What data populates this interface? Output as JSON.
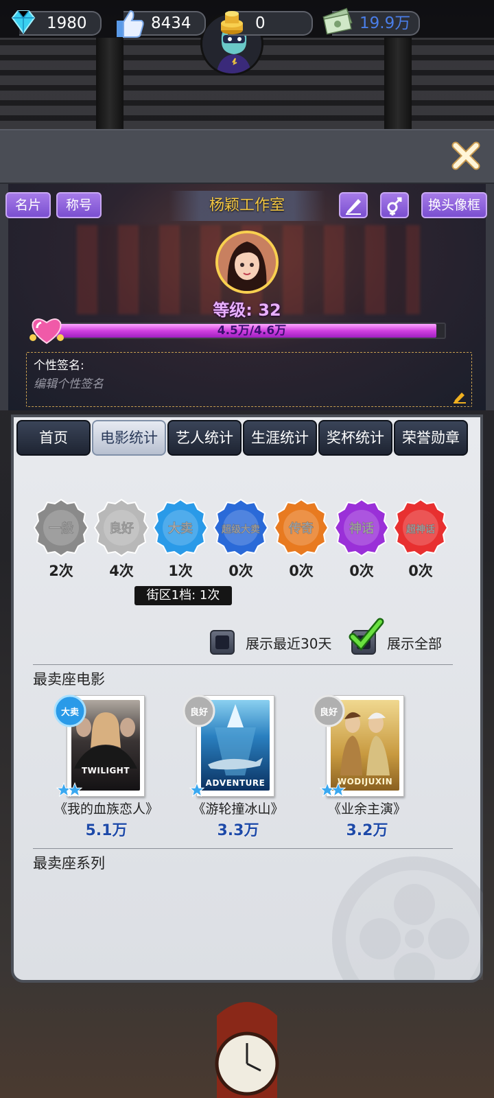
{
  "resources": [
    {
      "icon": "diamond-icon",
      "value": "1980"
    },
    {
      "icon": "thumbs-up-icon",
      "value": "8434"
    },
    {
      "icon": "gold-coins-icon",
      "value": "0"
    },
    {
      "icon": "cash-icon",
      "value": "19.9万",
      "color": "#4a7ee8"
    }
  ],
  "profile": {
    "card_label": "名片",
    "title_label": "称号",
    "studio_name": "杨颖工作室",
    "frame_label": "换头像框",
    "level": "等级: 32",
    "xp_text": "4.5万/4.6万",
    "xp_fraction": 0.978,
    "signature_label": "个性签名:",
    "signature_placeholder": "编辑个性签名"
  },
  "tabs": [
    "首页",
    "电影统计",
    "艺人统计",
    "生涯统计",
    "奖杯统计",
    "荣誉勋章"
  ],
  "active_tab": 1,
  "badges": [
    {
      "label": "一般",
      "count": "2次",
      "color": "#8a8a8a"
    },
    {
      "label": "良好",
      "count": "4次",
      "color": "#b8b8b8"
    },
    {
      "label": "大卖",
      "count": "1次",
      "color": "#2a9ae8"
    },
    {
      "label": "超级大卖",
      "count": "0次",
      "color": "#2a6ad8"
    },
    {
      "label": "传奇",
      "count": "0次",
      "color": "#e87a20"
    },
    {
      "label": "神话",
      "count": "0次",
      "color": "#9a30d8"
    },
    {
      "label": "超神话",
      "count": "0次",
      "color": "#e83030"
    }
  ],
  "tooltip": "街区1档: 1次",
  "filters": {
    "recent": "展示最近30天",
    "all": "展示全部",
    "all_checked": true
  },
  "best_movies": {
    "heading": "最卖座电影",
    "items": [
      {
        "name": "《我的血族恋人》",
        "value": "5.1万",
        "badge": "大卖",
        "poster_text": "TWILIGHT"
      },
      {
        "name": "《游轮撞冰山》",
        "value": "3.3万",
        "badge": "良好",
        "poster_text": "ADVENTURE"
      },
      {
        "name": "《业余主演》",
        "value": "3.2万",
        "badge": "良好",
        "poster_text": "WODIJUXIN"
      }
    ]
  },
  "best_series": {
    "heading": "最卖座系列"
  }
}
